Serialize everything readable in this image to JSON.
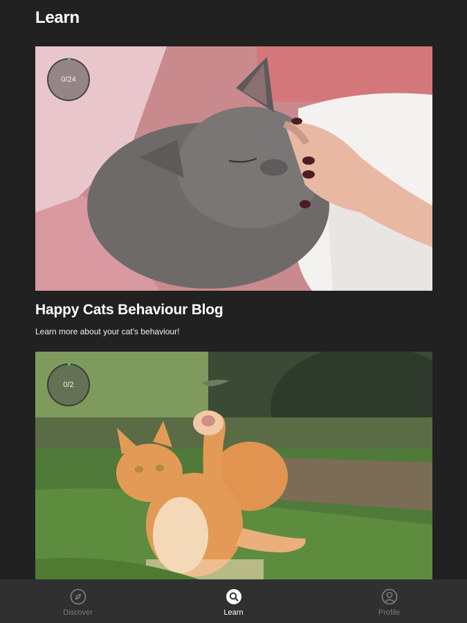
{
  "header": {
    "title": "Learn"
  },
  "cards": [
    {
      "title": "Happy Cats Behaviour Blog",
      "description": "Learn more about your cat's behaviour!",
      "progress": "0/24"
    },
    {
      "title": "",
      "description": "",
      "progress": "0/2"
    }
  ],
  "bottom_nav": {
    "items": [
      {
        "label": "Discover",
        "icon": "compass-icon",
        "active": false
      },
      {
        "label": "Learn",
        "icon": "learn-search-icon",
        "active": true
      },
      {
        "label": "Profile",
        "icon": "profile-icon",
        "active": false
      }
    ]
  },
  "colors": {
    "background": "#212121",
    "nav_background": "#303030",
    "accent": "#3ecf8e"
  }
}
